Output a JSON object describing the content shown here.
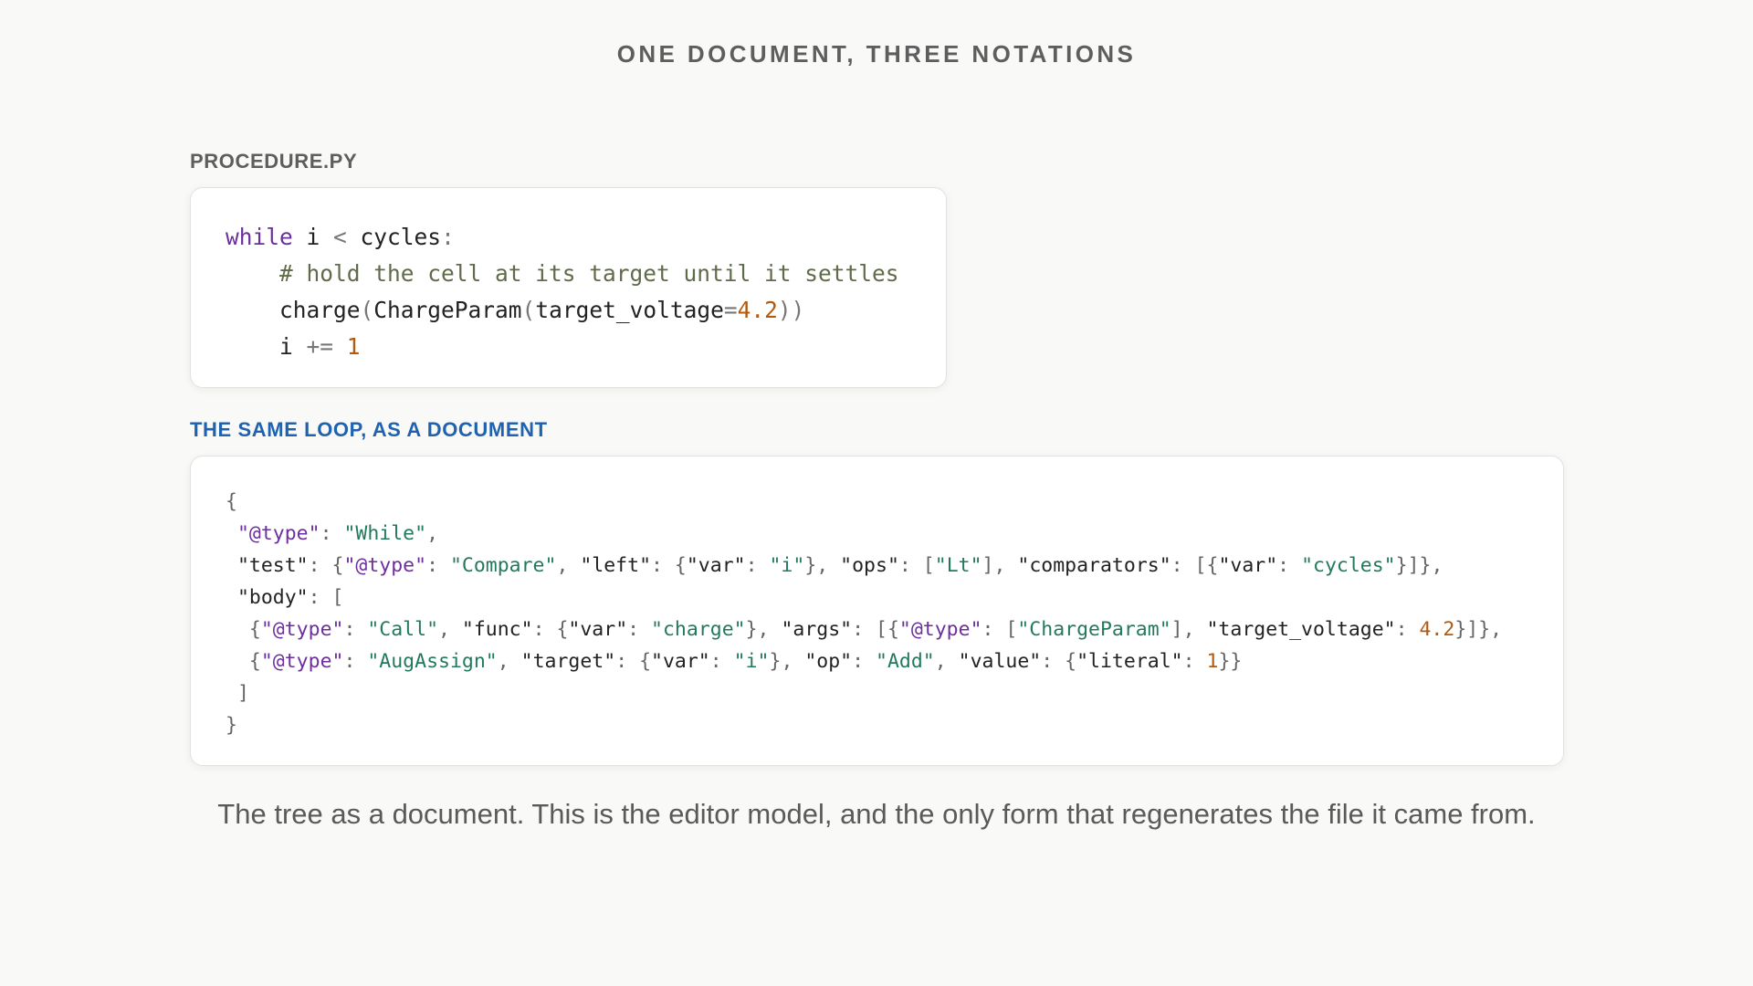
{
  "page": {
    "title": "ONE DOCUMENT, THREE NOTATIONS",
    "caption": "The tree as a document. This is the editor model, and the only form that regenerates the file it came from."
  },
  "python_panel": {
    "label": "PROCEDURE.PY",
    "lines": [
      [
        {
          "t": "while",
          "c": "kw"
        },
        {
          "t": " i ",
          "c": "plain"
        },
        {
          "t": "<",
          "c": "op"
        },
        {
          "t": " cycles",
          "c": "plain"
        },
        {
          "t": ":",
          "c": "op"
        }
      ],
      [
        {
          "t": "    # hold the cell at its target until it settles",
          "c": "cm"
        }
      ],
      [
        {
          "t": "    charge",
          "c": "plain"
        },
        {
          "t": "(",
          "c": "op"
        },
        {
          "t": "ChargeParam",
          "c": "plain"
        },
        {
          "t": "(",
          "c": "op"
        },
        {
          "t": "target_voltage",
          "c": "plain"
        },
        {
          "t": "=",
          "c": "op"
        },
        {
          "t": "4.2",
          "c": "num"
        },
        {
          "t": "))",
          "c": "op"
        }
      ],
      [
        {
          "t": "    i ",
          "c": "plain"
        },
        {
          "t": "+=",
          "c": "op"
        },
        {
          "t": " ",
          "c": "plain"
        },
        {
          "t": "1",
          "c": "num"
        }
      ]
    ]
  },
  "document_panel": {
    "label": "THE SAME LOOP, AS A DOCUMENT",
    "lines": [
      [
        {
          "t": "{",
          "c": "punc"
        }
      ],
      [
        {
          "t": " ",
          "c": "plain"
        },
        {
          "t": "\"@type\"",
          "c": "typekey"
        },
        {
          "t": ": ",
          "c": "punc"
        },
        {
          "t": "\"While\"",
          "c": "str"
        },
        {
          "t": ",",
          "c": "punc"
        }
      ],
      [
        {
          "t": " \"test\"",
          "c": "plain"
        },
        {
          "t": ": {",
          "c": "punc"
        },
        {
          "t": "\"@type\"",
          "c": "typekey"
        },
        {
          "t": ": ",
          "c": "punc"
        },
        {
          "t": "\"Compare\"",
          "c": "str"
        },
        {
          "t": ", ",
          "c": "punc"
        },
        {
          "t": "\"left\"",
          "c": "plain"
        },
        {
          "t": ": {",
          "c": "punc"
        },
        {
          "t": "\"var\"",
          "c": "plain"
        },
        {
          "t": ": ",
          "c": "punc"
        },
        {
          "t": "\"i\"",
          "c": "str"
        },
        {
          "t": "}, ",
          "c": "punc"
        },
        {
          "t": "\"ops\"",
          "c": "plain"
        },
        {
          "t": ": [",
          "c": "punc"
        },
        {
          "t": "\"Lt\"",
          "c": "str"
        },
        {
          "t": "], ",
          "c": "punc"
        },
        {
          "t": "\"comparators\"",
          "c": "plain"
        },
        {
          "t": ": [{",
          "c": "punc"
        },
        {
          "t": "\"var\"",
          "c": "plain"
        },
        {
          "t": ": ",
          "c": "punc"
        },
        {
          "t": "\"cycles\"",
          "c": "str"
        },
        {
          "t": "}]},",
          "c": "punc"
        }
      ],
      [
        {
          "t": " \"body\"",
          "c": "plain"
        },
        {
          "t": ": [",
          "c": "punc"
        }
      ],
      [
        {
          "t": "  {",
          "c": "punc"
        },
        {
          "t": "\"@type\"",
          "c": "typekey"
        },
        {
          "t": ": ",
          "c": "punc"
        },
        {
          "t": "\"Call\"",
          "c": "str"
        },
        {
          "t": ", ",
          "c": "punc"
        },
        {
          "t": "\"func\"",
          "c": "plain"
        },
        {
          "t": ": {",
          "c": "punc"
        },
        {
          "t": "\"var\"",
          "c": "plain"
        },
        {
          "t": ": ",
          "c": "punc"
        },
        {
          "t": "\"charge\"",
          "c": "str"
        },
        {
          "t": "}, ",
          "c": "punc"
        },
        {
          "t": "\"args\"",
          "c": "plain"
        },
        {
          "t": ": [{",
          "c": "punc"
        },
        {
          "t": "\"@type\"",
          "c": "typekey"
        },
        {
          "t": ": [",
          "c": "punc"
        },
        {
          "t": "\"ChargeParam\"",
          "c": "str"
        },
        {
          "t": "], ",
          "c": "punc"
        },
        {
          "t": "\"target_voltage\"",
          "c": "plain"
        },
        {
          "t": ": ",
          "c": "punc"
        },
        {
          "t": "4.2",
          "c": "num"
        },
        {
          "t": "}]},",
          "c": "punc"
        }
      ],
      [
        {
          "t": "  {",
          "c": "punc"
        },
        {
          "t": "\"@type\"",
          "c": "typekey"
        },
        {
          "t": ": ",
          "c": "punc"
        },
        {
          "t": "\"AugAssign\"",
          "c": "str"
        },
        {
          "t": ", ",
          "c": "punc"
        },
        {
          "t": "\"target\"",
          "c": "plain"
        },
        {
          "t": ": {",
          "c": "punc"
        },
        {
          "t": "\"var\"",
          "c": "plain"
        },
        {
          "t": ": ",
          "c": "punc"
        },
        {
          "t": "\"i\"",
          "c": "str"
        },
        {
          "t": "}, ",
          "c": "punc"
        },
        {
          "t": "\"op\"",
          "c": "plain"
        },
        {
          "t": ": ",
          "c": "punc"
        },
        {
          "t": "\"Add\"",
          "c": "str"
        },
        {
          "t": ", ",
          "c": "punc"
        },
        {
          "t": "\"value\"",
          "c": "plain"
        },
        {
          "t": ": {",
          "c": "punc"
        },
        {
          "t": "\"literal\"",
          "c": "plain"
        },
        {
          "t": ": ",
          "c": "punc"
        },
        {
          "t": "1",
          "c": "num"
        },
        {
          "t": "}}",
          "c": "punc"
        }
      ],
      [
        {
          "t": " ]",
          "c": "punc"
        }
      ],
      [
        {
          "t": "}",
          "c": "punc"
        }
      ]
    ]
  }
}
